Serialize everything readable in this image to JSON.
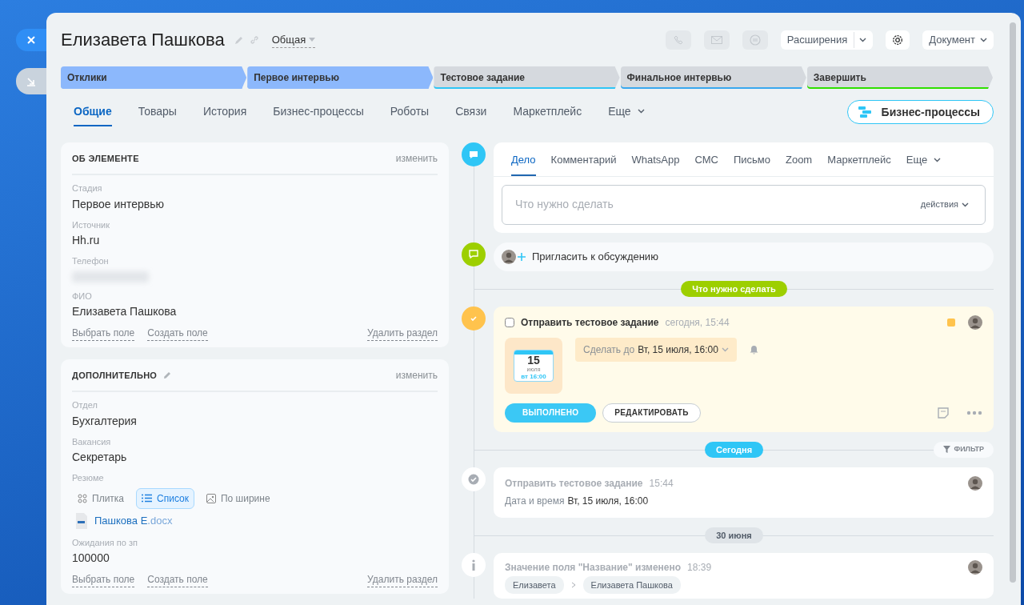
{
  "header": {
    "title": "Елизавета Пашкова",
    "category": "Общая",
    "extensions": "Расширения",
    "document": "Документ"
  },
  "stages": [
    {
      "label": "Отклики",
      "passed": true,
      "color": "#8cb8fc"
    },
    {
      "label": "Первое интервью",
      "passed": true,
      "color": "#8cb8fc"
    },
    {
      "label": "Тестовое задание",
      "passed": false,
      "color": "#2fc6f6"
    },
    {
      "label": "Финальное интервью",
      "passed": false,
      "color": "#39a8ef"
    },
    {
      "label": "Завершить",
      "passed": false,
      "color": "#2fe000"
    }
  ],
  "tabs": [
    {
      "label": "Общие",
      "selected": true,
      "kind": "tab"
    },
    {
      "label": "Товары",
      "selected": false,
      "kind": "tab"
    },
    {
      "label": "История",
      "selected": false,
      "kind": "tab"
    },
    {
      "label": "Бизнес-процессы",
      "selected": false,
      "kind": "tab"
    },
    {
      "label": "Роботы",
      "selected": false,
      "kind": "tab"
    },
    {
      "label": "Связи",
      "selected": false,
      "kind": "tab"
    },
    {
      "label": "Маркетплейс",
      "selected": false,
      "kind": "tab"
    },
    {
      "label": "Еще",
      "selected": false,
      "kind": "more"
    }
  ],
  "bp_button": "Бизнес-процессы",
  "sections": [
    {
      "title": "ОБ ЭЛЕМЕНТЕ",
      "editable": false,
      "action": "изменить",
      "fields": [
        {
          "kind": "text",
          "label": "Стадия",
          "value": "Первое интервью"
        },
        {
          "kind": "text",
          "label": "Источник",
          "value": "Hh.ru"
        },
        {
          "kind": "masked",
          "label": "Телефон"
        },
        {
          "kind": "text",
          "label": "ФИО",
          "value": "Елизавета Пашкова"
        }
      ],
      "links": [
        "Выбрать поле",
        "Создать поле"
      ],
      "delete": "Удалить раздел"
    },
    {
      "title": "ДОПОЛНИТЕЛЬНО",
      "editable": true,
      "action": "изменить",
      "fields": [
        {
          "kind": "text",
          "label": "Отдел",
          "value": "Бухгалтерия"
        },
        {
          "kind": "text",
          "label": "Вакансия",
          "value": "Секретарь"
        },
        {
          "kind": "files",
          "label": "Резюме",
          "views": [
            {
              "label": "Плитка",
              "selected": false,
              "kind": "tile"
            },
            {
              "label": "Список",
              "selected": true,
              "kind": "list"
            },
            {
              "label": "По ширине",
              "selected": false,
              "kind": "wide"
            }
          ],
          "file": {
            "name": "Пашкова Е",
            "ext": ".docx"
          }
        },
        {
          "kind": "text",
          "label": "Ожидания по зп",
          "value": "100000"
        }
      ],
      "links": [
        "Выбрать поле",
        "Создать поле"
      ],
      "delete": "Удалить раздел"
    }
  ],
  "timeline": [
    {
      "kind": "composer",
      "tabs": [
        {
          "label": "Дело",
          "selected": true,
          "kind": "tab"
        },
        {
          "label": "Комментарий",
          "selected": false,
          "kind": "tab"
        },
        {
          "label": "WhatsApp",
          "selected": false,
          "kind": "tab"
        },
        {
          "label": "СМС",
          "selected": false,
          "kind": "tab"
        },
        {
          "label": "Письмо",
          "selected": false,
          "kind": "tab"
        },
        {
          "label": "Zoom",
          "selected": false,
          "kind": "tab"
        },
        {
          "label": "Маркетплейс",
          "selected": false,
          "kind": "tab"
        },
        {
          "label": "Еще",
          "selected": false,
          "kind": "more"
        }
      ],
      "placeholder": "Что нужно сделать",
      "actions": "действия"
    },
    {
      "kind": "invite",
      "text": "Пригласить к обсуждению"
    },
    {
      "kind": "divider",
      "color": "#9dcf00",
      "text": "Что нужно сделать"
    },
    {
      "kind": "task",
      "checked": false,
      "title": "Отправить тестовое задание",
      "time": "сегодня, 15:44",
      "day": "15",
      "month": "июля",
      "weekday_time": "вт 16:00",
      "deadline_label": "Сделать до",
      "deadline": "Вт, 15 июля, 16:00",
      "done_button": "ВЫПОЛНЕНО",
      "edit_button": "РЕДАКТИРОВАТЬ"
    },
    {
      "kind": "divider",
      "color": "#2fc6f6",
      "text": "Сегодня",
      "filter": "ФИЛЬТР"
    },
    {
      "kind": "done",
      "title": "Отправить тестовое задание",
      "time": "15:44",
      "detail_label": "Дата и время",
      "detail": "Вт, 15 июля, 16:00"
    },
    {
      "kind": "divider",
      "color": "#dfe4e8",
      "text": "30 июня"
    },
    {
      "kind": "info",
      "title": "Значение поля \"Название\" изменено",
      "time": "18:39",
      "from": "Елизавета",
      "to": "Елизавета Пашкова"
    }
  ]
}
